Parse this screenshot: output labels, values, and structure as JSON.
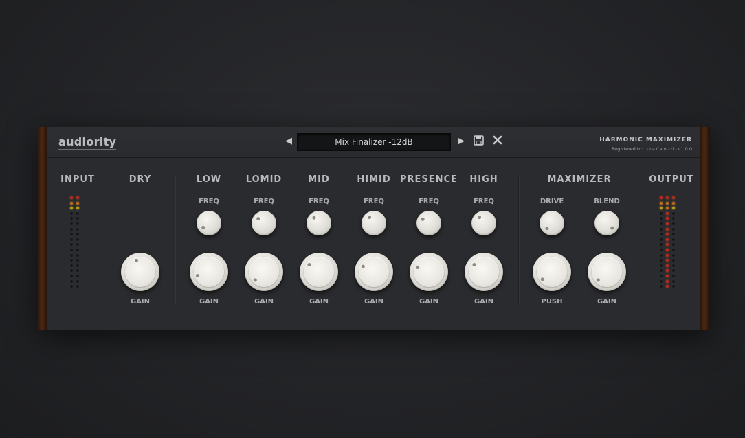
{
  "header": {
    "logo": "audiority",
    "preset_name": "Mix Finalizer -12dB",
    "product_title": "HARMONIC MAXIMIZER",
    "registered": "Registered to: Luca Capozzi - v1.0.0",
    "buttons": {
      "prev": "prev-arrow-icon",
      "next": "next-arrow-icon",
      "save": "save-icon",
      "close": "close-icon"
    }
  },
  "sections": {
    "input": "INPUT",
    "dry": "DRY",
    "low": "LOW",
    "lomid": "LOMID",
    "mid": "MID",
    "himid": "HIMID",
    "presence": "PRESENCE",
    "high": "HIGH",
    "maximizer": "MAXIMIZER",
    "output": "OUTPUT"
  },
  "labels": {
    "freq": "FREQ",
    "gain": "GAIN",
    "drive": "DRIVE",
    "blend": "BLEND",
    "push": "PUSH"
  },
  "colors": {
    "panel": "#2a2b2e",
    "knob": "#e8e6e0",
    "led_red": "#b92b1c",
    "led_orange": "#c76a17",
    "led_yellow": "#b99a15"
  },
  "meters": {
    "input": {
      "columns": 2,
      "leds": 18
    },
    "output": {
      "columns": 3,
      "leds": 18
    }
  }
}
